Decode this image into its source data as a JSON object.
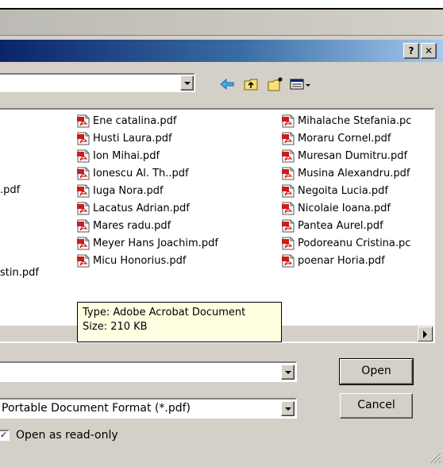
{
  "titlebar": {
    "help_label": "?",
    "close_label": "✕"
  },
  "toolbar": {
    "back_icon": "back-arrow-icon",
    "up_icon": "up-folder-icon",
    "new_folder_icon": "new-folder-icon",
    "views_icon": "views-menu-icon"
  },
  "files": {
    "col1": [
      "Ene catalina.pdf",
      "Husti Laura.pdf",
      "Ion Mihai.pdf",
      "Ionescu Al. Th..pdf",
      "Iuga Nora.pdf",
      "Lacatus Adrian.pdf",
      "Mares radu.pdf",
      "Meyer Hans Joachim.pdf",
      "Micu Honorius.pdf"
    ],
    "col2": [
      "Mihalache Stefania.pc",
      "Moraru Cornel.pdf",
      "Muresan Dumitru.pdf",
      "Musina Alexandru.pdf",
      "Negoita Lucia.pdf",
      "Nicolaie Ioana.pdf",
      "Pantea Aurel.pdf",
      "Podoreanu Cristina.pc",
      "poenar Horia.pdf"
    ],
    "left_frag1": ".pdf",
    "left_frag2": "stin.pdf"
  },
  "tooltip": {
    "type_line": "Type: Adobe Acrobat Document",
    "size_line": "Size: 210 KB"
  },
  "bottom": {
    "filename_value": "",
    "filetype_value": "Portable Document Format (*.pdf)",
    "open_label": "Open",
    "cancel_label": "Cancel",
    "readonly_label": "Open as read-only",
    "readonly_checked": true,
    "check_mark": "✓"
  }
}
